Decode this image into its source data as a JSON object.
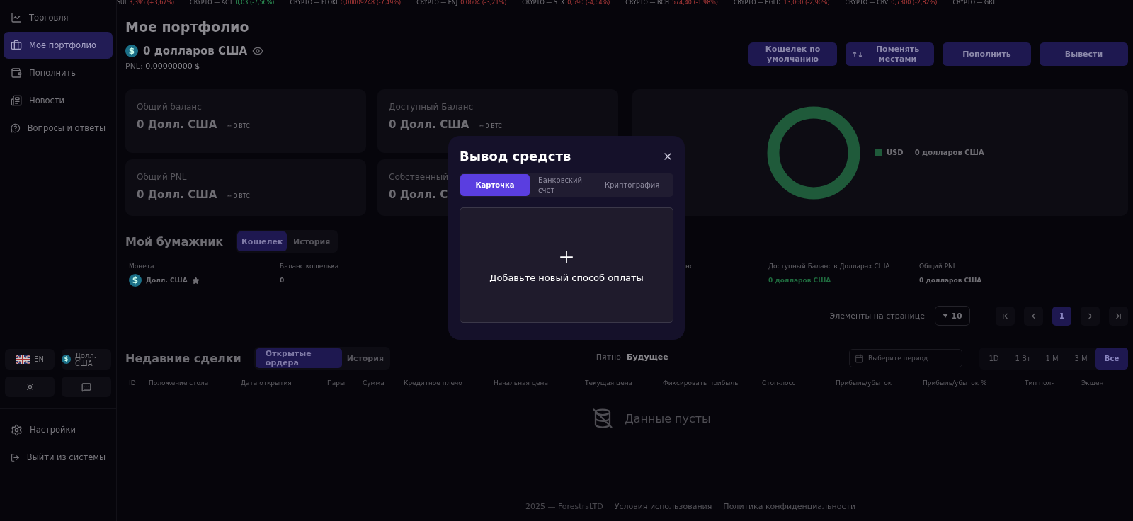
{
  "ticker": [
    {
      "label": "SUI",
      "value": "3,395 (+3,67%)",
      "up": false
    },
    {
      "label": "CRYPTO — ACT",
      "value": "0,03 (-7,56%)",
      "up": true
    },
    {
      "label": "CRYPTO — FLOKI",
      "value": "0,00009248 (-7,49%)",
      "up": false
    },
    {
      "label": "CRYPTO — ENJ",
      "value": "0,0604 (-3,21%)",
      "up": false
    },
    {
      "label": "CRYPTO — STX",
      "value": "0,590 (-4,64%)",
      "up": false
    },
    {
      "label": "CRYPTO — BCH",
      "value": "574,40 (-1,98%)",
      "up": false
    },
    {
      "label": "CRYPTO — EGLD",
      "value": "13,060 (-2,90%)",
      "up": false
    },
    {
      "label": "CRYPTO — CRV",
      "value": "0,7300 (-2,82%)",
      "up": false
    },
    {
      "label": "CRYPTO — GRT"
    }
  ],
  "sidebar": {
    "items": [
      {
        "label": "Торговля",
        "selected": false
      },
      {
        "label": "Мое портфолио",
        "selected": true
      },
      {
        "label": "Пополнить",
        "selected": false
      },
      {
        "label": "Новости",
        "selected": false
      },
      {
        "label": "Вопросы и ответы",
        "selected": false
      }
    ],
    "language": "EN",
    "currency_symbol": "$",
    "currency": "Долл. США",
    "bottom_items": [
      {
        "label": "Настройки"
      },
      {
        "label": "Выйти из системы"
      }
    ]
  },
  "header": {
    "title": "Мое портфолио",
    "balance_symbol": "$",
    "balance": "0 долларов США",
    "pnl_label": "PNL:",
    "pnl_value": "0.00000000 $",
    "buttons": [
      {
        "label": "Кошелек по умолчанию",
        "kind": "plain"
      },
      {
        "label": "Поменять местами",
        "kind": "swap"
      },
      {
        "label": "Пополнить",
        "kind": "plain"
      },
      {
        "label": "Вывести",
        "kind": "plain"
      }
    ]
  },
  "cards": [
    {
      "label": "Общий баланс",
      "value": "0 Долл. США",
      "approx": "≈ 0 BTC"
    },
    {
      "label": "Доступный Баланс",
      "value": "0 Долл. США",
      "approx": "≈ 0 BTC"
    },
    {
      "label": "Общий PNL",
      "value": "0 Долл. США",
      "approx": "≈ 0 BTC"
    },
    {
      "label": "Собственный",
      "value": "0 Долл. С"
    }
  ],
  "allocation": {
    "legend": [
      {
        "label": "USD",
        "value": "0 долларов США",
        "color": "#1f5a3a"
      }
    ]
  },
  "wallet": {
    "title": "Мой бумажник",
    "tabs": [
      {
        "label": "Кошелек",
        "selected": true
      },
      {
        "label": "История",
        "selected": false
      }
    ],
    "columns": [
      "Монета",
      "Баланс кошелька",
      "нс",
      "Доступный Баланс в Долларах США",
      "Общий PNL"
    ],
    "rows": [
      {
        "symbol": "$",
        "coin": "Долл. США",
        "starred": true,
        "balance": "0",
        "available": "0 долларов США",
        "pnl": "0 долларов США"
      }
    ]
  },
  "pagination": {
    "label": "Элементы на странице",
    "per_page": "10",
    "pages": [
      {
        "label": "1",
        "selected": true
      }
    ]
  },
  "trades": {
    "title": "Недавние сделки",
    "tabs": [
      {
        "label": "Открытые ордера",
        "selected": true
      },
      {
        "label": "История",
        "selected": false
      }
    ],
    "markets": [
      {
        "label": "Пятно",
        "selected": false
      },
      {
        "label": "Будущее",
        "selected": true
      }
    ],
    "period_placeholder": "Выберите период",
    "periods": [
      {
        "label": "1D",
        "selected": false
      },
      {
        "label": "1 Вт",
        "selected": false
      },
      {
        "label": "1 М",
        "selected": false
      },
      {
        "label": "3 М",
        "selected": false
      },
      {
        "label": "Все",
        "selected": true
      }
    ],
    "columns": [
      "ID",
      "Положение стола",
      "Дата открытия",
      "Пары",
      "Сумма",
      "Кредитное плечо",
      "Начальная цена",
      "Текущая цена",
      "Фиксировать прибыль",
      "Стоп-лосс",
      "Прибыль/убыток",
      "Прибыль/убыток %",
      "Тип поля",
      "Экшен"
    ],
    "empty": "Данные пусты"
  },
  "footer": {
    "copyright": "2025 — ForestrsLTD",
    "links": [
      "Условия использования",
      "Политика конфиденциальности"
    ]
  },
  "modal": {
    "title": "Вывод средств",
    "tabs": [
      {
        "label": "Карточка",
        "selected": true
      },
      {
        "label": "Банковский счет",
        "selected": false
      },
      {
        "label": "Криптография",
        "selected": false
      }
    ],
    "add_label": "Добавьте новый способ оплаты"
  }
}
